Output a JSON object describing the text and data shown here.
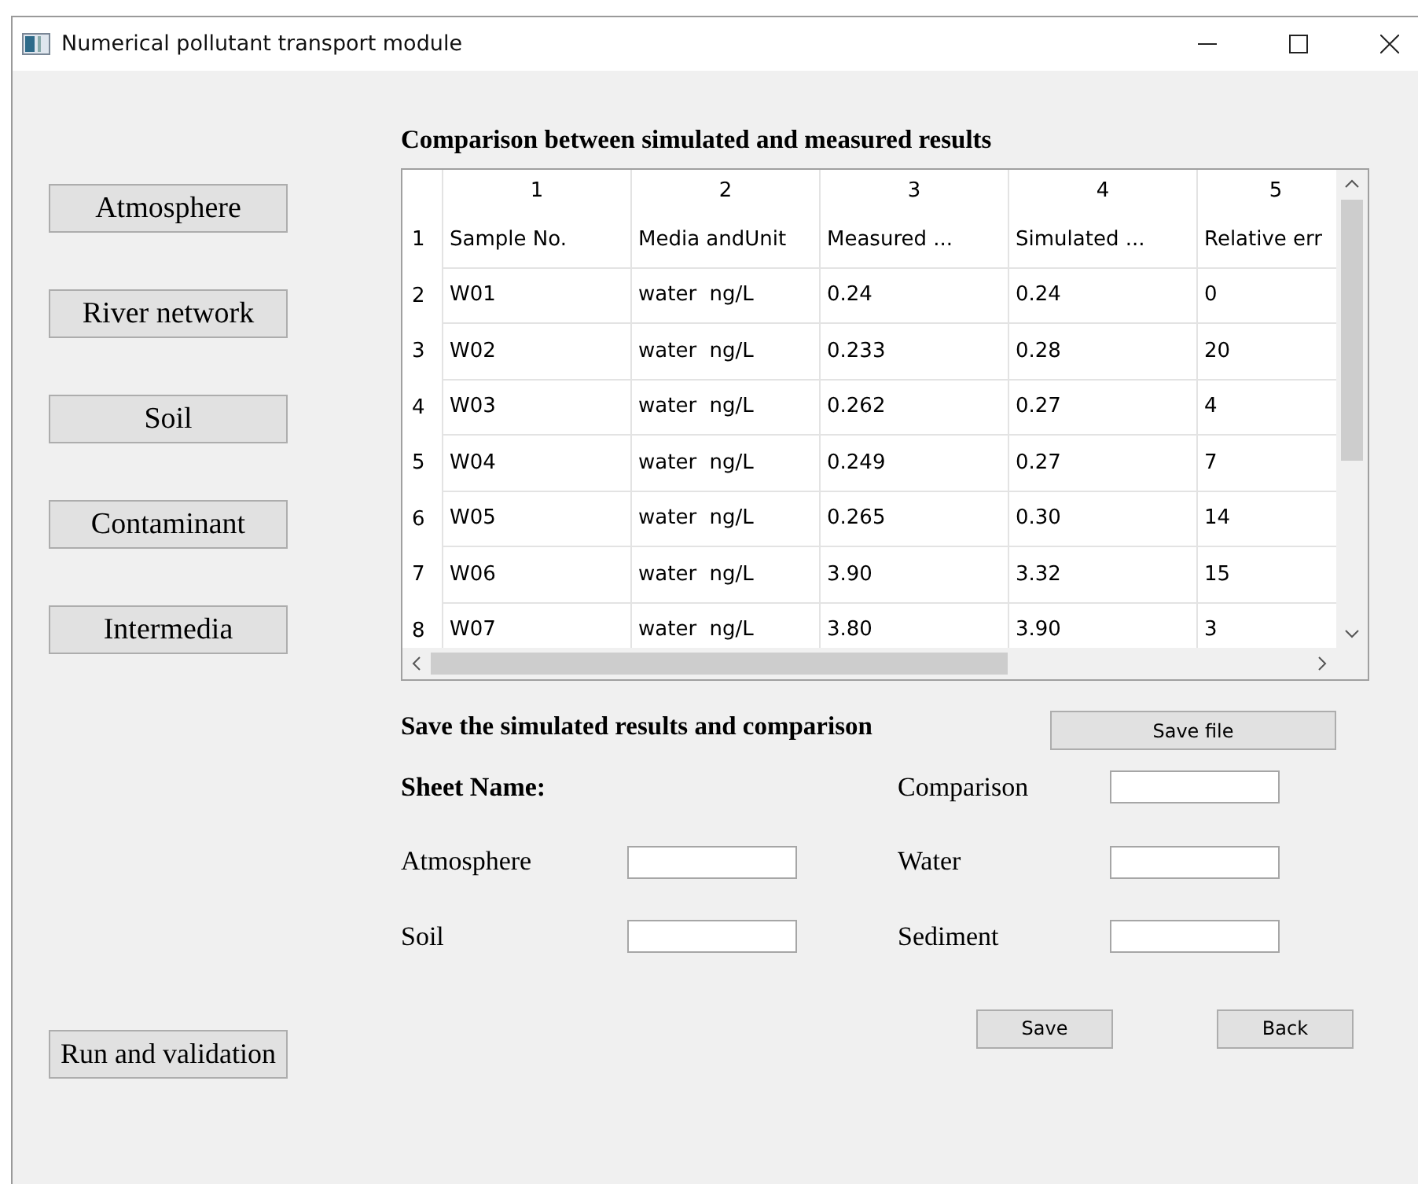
{
  "window": {
    "title": "Numerical pollutant transport module"
  },
  "nav_buttons": [
    "Atmosphere",
    "River network",
    "Soil",
    "Contaminant",
    "Intermedia"
  ],
  "run_button": "Run and validation",
  "comparison": {
    "title": "Comparison between simulated and measured results",
    "table": {
      "columns": [
        "1",
        "2",
        "3",
        "4",
        "5"
      ],
      "rows": [
        {
          "number": "1",
          "cells": [
            "Sample No.",
            "Media andUnit",
            "Measured ...",
            "Simulated ...",
            "Relative err"
          ]
        },
        {
          "number": "2",
          "cells": [
            "W01",
            "water  ng/L",
            "0.24",
            "0.24",
            "0"
          ]
        },
        {
          "number": "3",
          "cells": [
            "W02",
            "water  ng/L",
            "0.233",
            "0.28",
            "20"
          ]
        },
        {
          "number": "4",
          "cells": [
            "W03",
            "water  ng/L",
            "0.262",
            "0.27",
            "4"
          ]
        },
        {
          "number": "5",
          "cells": [
            "W04",
            "water  ng/L",
            "0.249",
            "0.27",
            "7"
          ]
        },
        {
          "number": "6",
          "cells": [
            "W05",
            "water  ng/L",
            "0.265",
            "0.30",
            "14"
          ]
        },
        {
          "number": "7",
          "cells": [
            "W06",
            "water  ng/L",
            "3.90",
            "3.32",
            "15"
          ]
        },
        {
          "number": "8",
          "cells": [
            "W07",
            "water  ng/L",
            "3.80",
            "3.90",
            "3"
          ]
        }
      ]
    }
  },
  "save_section": {
    "title": "Save the simulated results and comparison",
    "save_file_button": "Save file",
    "sheet_label": "Sheet Name:",
    "fields": [
      {
        "label": "Comparison"
      },
      {
        "label": "Atmosphere"
      },
      {
        "label": "Water"
      },
      {
        "label": "Soil"
      },
      {
        "label": "Sediment"
      }
    ]
  },
  "buttons": [
    "Save",
    "Back"
  ]
}
